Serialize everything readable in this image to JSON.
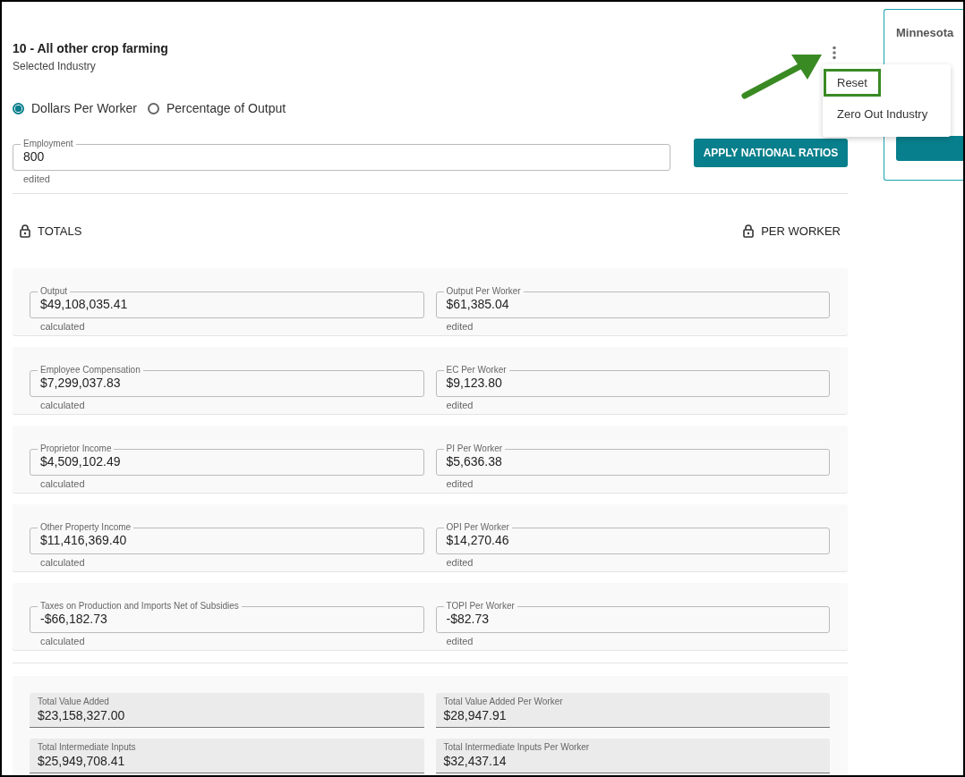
{
  "industry": {
    "title": "10 - All other crop farming",
    "subtitle": "Selected Industry"
  },
  "menu": {
    "items": [
      {
        "label": "Reset",
        "highlighted": true
      },
      {
        "label": "Zero Out Industry",
        "highlighted": false
      }
    ]
  },
  "mode": [
    {
      "label": "Dollars Per Worker",
      "selected": true
    },
    {
      "label": "Percentage of Output",
      "selected": false
    }
  ],
  "employment": {
    "label": "Employment",
    "value": "800",
    "status": "edited"
  },
  "apply_button": "APPLY NATIONAL RATIOS",
  "headers": {
    "totals": "TOTALS",
    "per_worker": "PER WORKER"
  },
  "rows": [
    {
      "left": {
        "label": "Output",
        "value": "$49,108,035.41",
        "status": "calculated"
      },
      "right": {
        "label": "Output Per Worker",
        "value": "$61,385.04",
        "status": "edited"
      }
    },
    {
      "left": {
        "label": "Employee Compensation",
        "value": "$7,299,037.83",
        "status": "calculated"
      },
      "right": {
        "label": "EC Per Worker",
        "value": "$9,123.80",
        "status": "edited"
      }
    },
    {
      "left": {
        "label": "Proprietor Income",
        "value": "$4,509,102.49",
        "status": "calculated"
      },
      "right": {
        "label": "PI Per Worker",
        "value": "$5,636.38",
        "status": "edited"
      }
    },
    {
      "left": {
        "label": "Other Property Income",
        "value": "$11,416,369.40",
        "status": "calculated"
      },
      "right": {
        "label": "OPI Per Worker",
        "value": "$14,270.46",
        "status": "edited"
      }
    },
    {
      "left": {
        "label": "Taxes on Production and Imports Net of Subsidies",
        "value": "-$66,182.73",
        "status": "calculated"
      },
      "right": {
        "label": "TOPI Per Worker",
        "value": "-$82.73",
        "status": "edited"
      }
    }
  ],
  "totals": [
    {
      "left": {
        "label": "Total Value Added",
        "value": "$23,158,327.00"
      },
      "right": {
        "label": "Total Value Added Per Worker",
        "value": "$28,947.91"
      }
    },
    {
      "left": {
        "label": "Total Intermediate Inputs",
        "value": "$25,949,708.41"
      },
      "right": {
        "label": "Total Intermediate Inputs Per Worker",
        "value": "$32,437.14"
      }
    }
  ],
  "side_card": {
    "title": "Minnesota"
  }
}
